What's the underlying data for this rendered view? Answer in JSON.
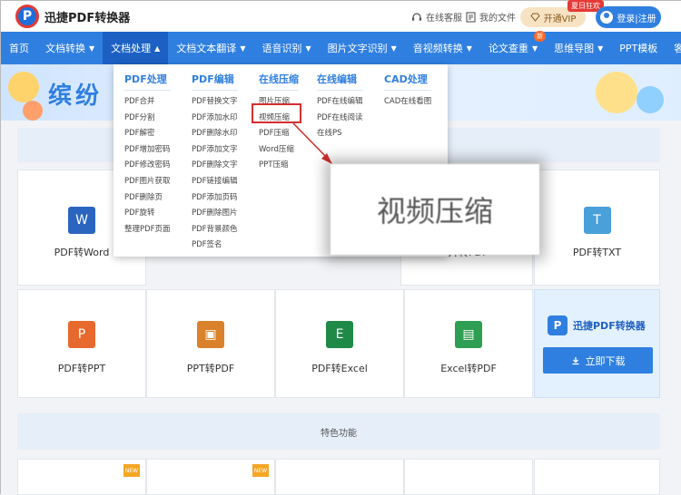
{
  "header": {
    "logo_mark": "P",
    "app_name": "迅捷PDF转换器",
    "service_link": "在线客服",
    "files_link": "我的文件",
    "vip_button": "开通VIP",
    "vip_badge": "夏日狂欢",
    "login_button": "登录|注册"
  },
  "nav": {
    "items": [
      {
        "label": "首页"
      },
      {
        "label": "文档转换",
        "caret": "▼"
      },
      {
        "label": "文档处理",
        "caret": "▲"
      },
      {
        "label": "文档文本翻译",
        "caret": "▼"
      },
      {
        "label": "语音识别",
        "caret": "▼"
      },
      {
        "label": "图片文字识别",
        "caret": "▼"
      },
      {
        "label": "音视频转换",
        "caret": "▼"
      },
      {
        "label": "论文查重",
        "caret": "▼"
      },
      {
        "label": "思维导图",
        "caret": "▼"
      },
      {
        "label": "PPT模板"
      },
      {
        "label": "客户端",
        "caret": "▼"
      }
    ],
    "new_badge": "新"
  },
  "banner": {
    "title": "缤纷"
  },
  "dropdown": {
    "columns": [
      {
        "title": "PDF处理",
        "items": [
          "PDF合并",
          "PDF分割",
          "PDF解密",
          "PDF增加密码",
          "PDF修改密码",
          "PDF图片获取",
          "PDF删除页",
          "PDF旋转",
          "整理PDF页面"
        ]
      },
      {
        "title": "PDF编辑",
        "items": [
          "PDF替换文字",
          "PDF添加水印",
          "PDF删除水印",
          "PDF添加文字",
          "PDF删除文字",
          "PDF链接编辑",
          "PDF添加页码",
          "PDF删除图片",
          "PDF背景颜色",
          "PDF签名"
        ]
      },
      {
        "title": "在线压缩",
        "items": [
          "图片压缩",
          "视频压缩",
          "PDF压缩",
          "Word压缩",
          "PPT压缩"
        ]
      },
      {
        "title": "在线编辑",
        "items": [
          "PDF在线编辑",
          "PDF在线阅读",
          "在线PS"
        ]
      },
      {
        "title": "CAD处理",
        "items": [
          "CAD在线看图"
        ]
      }
    ]
  },
  "zoom_callout": "视频压缩",
  "cards_row1": [
    {
      "label": "PDF转Word",
      "icon": "W",
      "color": "#2b65c0"
    },
    {
      "label": "PDF转TXT",
      "icon": "T",
      "color": "#4aa0d8"
    }
  ],
  "cards_row1_partial": "片转PDF",
  "cards_row2": [
    {
      "label": "PDF转PPT",
      "icon": "P",
      "color": "#e8692d"
    },
    {
      "label": "PPT转PDF",
      "icon": "▣",
      "color": "#d9822b"
    },
    {
      "label": "PDF转Excel",
      "icon": "E",
      "color": "#1f8a47"
    },
    {
      "label": "Excel转PDF",
      "icon": "▤",
      "color": "#2e9e52"
    }
  ],
  "promo": {
    "logo": "P",
    "title": "迅捷PDF转换器",
    "button": "立即下载"
  },
  "feature_bar": "特色功能",
  "new_tag": "NEW"
}
